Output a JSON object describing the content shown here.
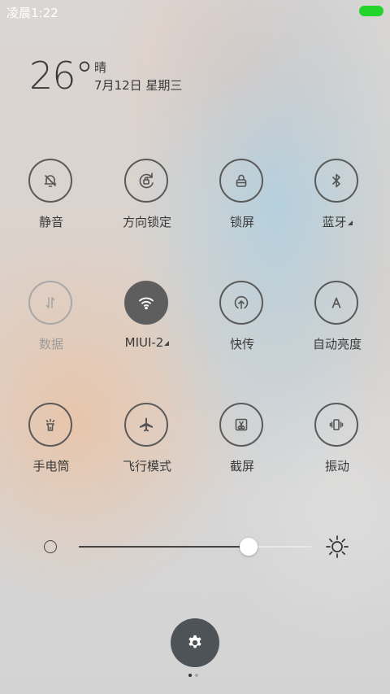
{
  "status_bar": {
    "time": "凌晨1:22",
    "battery_color": "#22d42c"
  },
  "weather": {
    "temperature": "26°",
    "condition": "晴",
    "date": "7月12日 星期三"
  },
  "toggles": [
    {
      "label": "静音",
      "icon": "bell-off-icon",
      "state": "off-outline"
    },
    {
      "label": "方向锁定",
      "icon": "rotation-lock-icon",
      "state": "outline"
    },
    {
      "label": "锁屏",
      "icon": "lock-icon",
      "state": "outline"
    },
    {
      "label": "蓝牙",
      "icon": "bluetooth-icon",
      "state": "outline",
      "has_menu": true
    },
    {
      "label": "数据",
      "icon": "mobile-data-icon",
      "state": "disabled"
    },
    {
      "label": "MIUI-2",
      "icon": "wifi-icon",
      "state": "active",
      "has_menu": true
    },
    {
      "label": "快传",
      "icon": "fast-transfer-icon",
      "state": "outline"
    },
    {
      "label": "自动亮度",
      "icon": "auto-brightness-icon",
      "state": "outline"
    },
    {
      "label": "手电筒",
      "icon": "flashlight-icon",
      "state": "outline"
    },
    {
      "label": "飞行模式",
      "icon": "airplane-icon",
      "state": "outline"
    },
    {
      "label": "截屏",
      "icon": "screenshot-icon",
      "state": "outline"
    },
    {
      "label": "振动",
      "icon": "vibrate-icon",
      "state": "outline"
    }
  ],
  "brightness": {
    "level": 0.73,
    "min_icon": "brightness-low-icon",
    "max_icon": "brightness-high-icon"
  },
  "settings": {
    "icon": "gear-icon"
  },
  "pager": {
    "count": 2,
    "active": 0
  }
}
